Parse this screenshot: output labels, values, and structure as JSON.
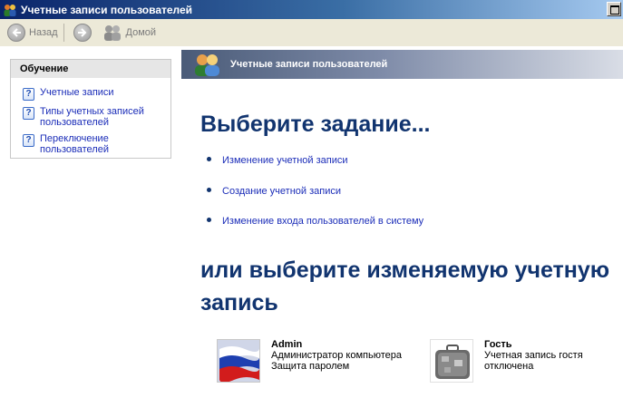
{
  "window": {
    "title": "Учетные записи пользователей"
  },
  "toolbar": {
    "back_label": "Назад",
    "home_label": "Домой"
  },
  "sidebar": {
    "header": "Обучение",
    "items": [
      {
        "label": "Учетные записи"
      },
      {
        "label": "Типы учетных записей пользователей"
      },
      {
        "label": "Переключение пользователей"
      }
    ]
  },
  "main": {
    "band_title": "Учетные записи пользователей",
    "heading": "Выберите задание...",
    "tasks": [
      {
        "label": "Изменение учетной записи"
      },
      {
        "label": "Создание учетной записи"
      },
      {
        "label": "Изменение входа пользователей в систему"
      }
    ],
    "heading2": "или выберите изменяемую учетную запись",
    "accounts": [
      {
        "name": "Admin",
        "line1": "Администратор компьютера",
        "line2": "Защита паролем"
      },
      {
        "name": "Гость",
        "line1": "Учетная запись гостя",
        "line2": "отключена"
      }
    ]
  },
  "colors": {
    "heading": "#11346f",
    "link": "#1b2db8",
    "titlebar": "#0a246a"
  }
}
